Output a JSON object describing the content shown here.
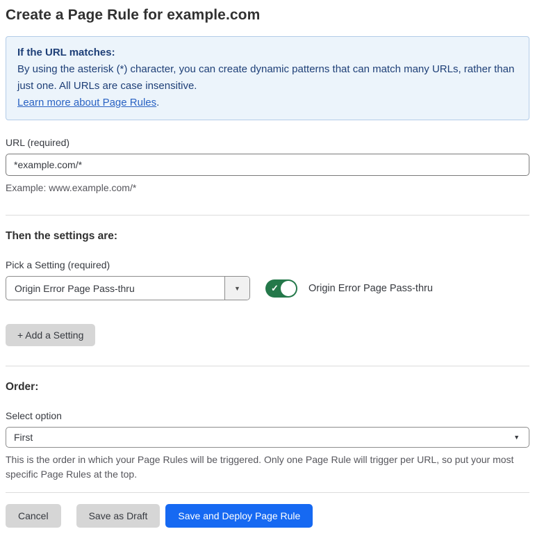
{
  "page": {
    "title": "Create a Page Rule for example.com"
  },
  "info_box": {
    "heading": "If the URL matches:",
    "body": "By using the asterisk (*) character, you can create dynamic patterns that can match many URLs, rather than just one. All URLs are case insensitive.",
    "link_label": "Learn more about Page Rules",
    "link_suffix": "."
  },
  "url_field": {
    "label": "URL (required)",
    "value": "*example.com/*",
    "example": "Example: www.example.com/*"
  },
  "settings_section": {
    "heading": "Then the settings are:",
    "picker_label": "Pick a Setting (required)",
    "picker_value": "Origin Error Page Pass-thru",
    "picker_arrow_icon": "▼",
    "toggle_state": "on",
    "toggle_check_icon": "✓",
    "toggle_label": "Origin Error Page Pass-thru",
    "add_setting_label": "+ Add a Setting"
  },
  "order_section": {
    "heading": "Order:",
    "select_label": "Select option",
    "select_value": "First",
    "select_arrow_icon": "▼",
    "help_text": "This is the order in which your Page Rules will be triggered. Only one Page Rule will trigger per URL, so put your most specific Page Rules at the top."
  },
  "footer": {
    "cancel_label": "Cancel",
    "save_draft_label": "Save as Draft",
    "save_deploy_label": "Save and Deploy Page Rule"
  },
  "colors": {
    "accent_blue": "#1669f2",
    "toggle_green": "#24784a",
    "info_background": "#ecf4fb",
    "info_border": "#b3cce8",
    "info_text": "#1e3f77",
    "link_blue": "#2962c3",
    "gray_button": "#d6d6d6"
  }
}
